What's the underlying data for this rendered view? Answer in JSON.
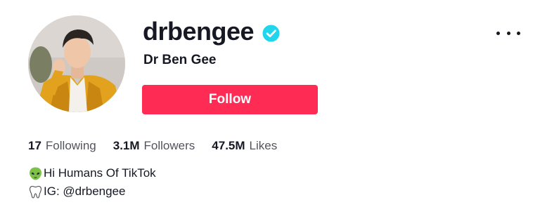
{
  "profile": {
    "username": "drbengee",
    "display_name": "Dr Ben Gee",
    "verified": true,
    "follow_label": "Follow",
    "accent_color": "#fe2c55",
    "verified_color": "#20d5ec",
    "avatar_icon": "avatar-photo",
    "more_icon": "more-horizontal-icon"
  },
  "stats": [
    {
      "value": "17",
      "label": "Following"
    },
    {
      "value": "3.1M",
      "label": "Followers"
    },
    {
      "value": "47.5M",
      "label": "Likes"
    }
  ],
  "bio": [
    {
      "icon": "alien-icon",
      "text": "Hi Humans Of TikTok"
    },
    {
      "icon": "tooth-icon",
      "text": "IG: @drbengee"
    }
  ]
}
